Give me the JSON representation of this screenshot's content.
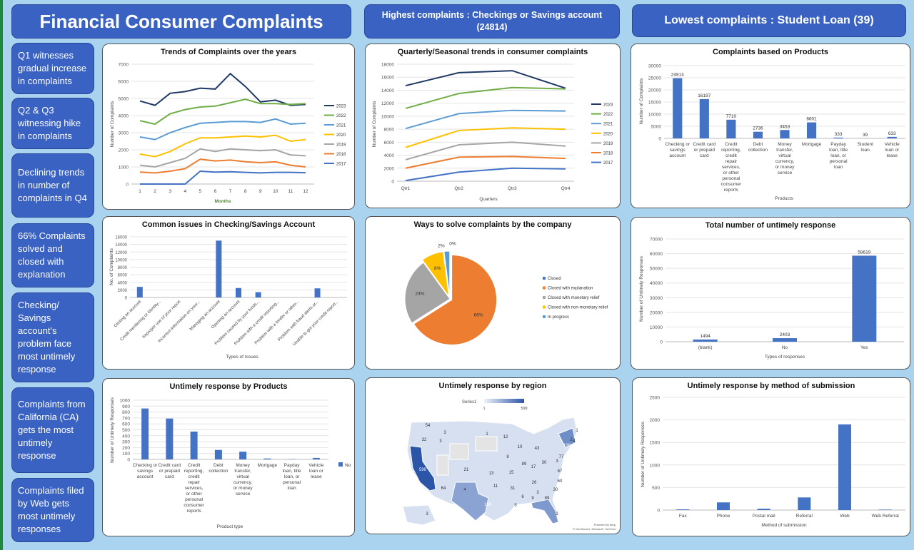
{
  "header": {
    "title": "Financial Consumer Complaints",
    "highest": "Highest complaints : Checkings or Savings account (24814)",
    "lowest": "Lowest complaints : Student Loan (39)"
  },
  "insights": [
    "Q1 witnesses gradual increase in complaints",
    "Q2 & Q3 witnessing hike in complaints",
    "Declining trends in number of complaints in Q4",
    "66% Complaints solved and closed with explanation",
    "Checking/ Savings account's problem face most untimely response",
    "Complaints from California (CA) gets the most untimely response",
    "Complaints filed by Web gets most untimely responses"
  ],
  "colors": {
    "y2023": "#1f3864",
    "y2022": "#70ad47",
    "y2021": "#5b9bd5",
    "y2020": "#ffc000",
    "y2019": "#a5a5a5",
    "y2018": "#ed7d31",
    "y2017": "#4472c4",
    "bar": "#4472c4"
  },
  "chart_data": [
    {
      "id": "trends",
      "type": "line",
      "title": "Trends of Complaints over the years",
      "xlabel": "Months",
      "ylabel": "Number of Complaints",
      "categories": [
        "1",
        "2",
        "3",
        "4",
        "5",
        "6",
        "7",
        "8",
        "9",
        "10",
        "11",
        "12"
      ],
      "ylim": [
        0,
        7000
      ],
      "yticks": [
        0,
        1000,
        2000,
        3000,
        4000,
        5000,
        6000,
        7000
      ],
      "series": [
        {
          "name": "2023",
          "values": [
            4850,
            4600,
            5300,
            5400,
            5600,
            5550,
            6450,
            5700,
            4800,
            4900,
            4600,
            4650
          ]
        },
        {
          "name": "2022",
          "values": [
            3700,
            3500,
            4100,
            4350,
            4500,
            4550,
            4750,
            4950,
            4700,
            4700,
            4650,
            4700
          ]
        },
        {
          "name": "2021",
          "values": [
            2750,
            2600,
            3000,
            3300,
            3550,
            3600,
            3650,
            3650,
            3600,
            3800,
            3500,
            3550
          ]
        },
        {
          "name": "2020",
          "values": [
            1750,
            1600,
            1900,
            2350,
            2700,
            2700,
            2750,
            2800,
            2750,
            2850,
            2500,
            2600
          ]
        },
        {
          "name": "2019",
          "values": [
            1100,
            1000,
            1250,
            1500,
            2050,
            1900,
            2050,
            2000,
            1950,
            2000,
            1700,
            1650
          ]
        },
        {
          "name": "2018",
          "values": [
            700,
            650,
            750,
            900,
            1450,
            1350,
            1400,
            1300,
            1250,
            1300,
            1100,
            1000
          ]
        },
        {
          "name": "2017",
          "values": [
            0,
            0,
            0,
            0,
            750,
            700,
            720,
            680,
            650,
            680,
            680,
            660
          ]
        }
      ]
    },
    {
      "id": "quarterly",
      "type": "line",
      "title": "Quarterly/Seasonal trends in consumer complaints",
      "xlabel": "Quarters",
      "ylabel": "Number of Complaints",
      "categories": [
        "Qtr1",
        "Qtr2",
        "Qtr3",
        "Qtr4"
      ],
      "ylim": [
        0,
        18000
      ],
      "yticks": [
        0,
        2000,
        4000,
        6000,
        8000,
        10000,
        12000,
        14000,
        16000,
        18000
      ],
      "series": [
        {
          "name": "2023",
          "values": [
            14700,
            16700,
            17000,
            14300
          ]
        },
        {
          "name": "2022",
          "values": [
            11200,
            13500,
            14400,
            14200
          ]
        },
        {
          "name": "2021",
          "values": [
            8100,
            10400,
            10900,
            10800
          ]
        },
        {
          "name": "2020",
          "values": [
            5200,
            7800,
            8200,
            8000
          ]
        },
        {
          "name": "2019",
          "values": [
            3300,
            5600,
            6000,
            5400
          ]
        },
        {
          "name": "2018",
          "values": [
            2000,
            3700,
            3800,
            3500
          ]
        },
        {
          "name": "2017",
          "values": [
            100,
            1400,
            2000,
            1900
          ]
        }
      ]
    },
    {
      "id": "products",
      "type": "bar",
      "title": "Complaints based on Products",
      "xlabel": "Products",
      "ylabel": "Number of Complaints",
      "categories": [
        "Checking or savings account",
        "Credit card or prepaid card",
        "Credit reporting, credit repair services, or other personal consumer reports",
        "Debt collection",
        "Money transfer, virtual currency, or money service",
        "Mortgage",
        "Payday loan, title loan, or personal loan",
        "Student loan",
        "Vehicle loan or lease"
      ],
      "values": [
        24814,
        16197,
        7710,
        2736,
        3453,
        6601,
        333,
        39,
        633
      ],
      "ylim": [
        0,
        30000
      ],
      "yticks": [
        0,
        5000,
        10000,
        15000,
        20000,
        25000,
        30000
      ]
    },
    {
      "id": "issues",
      "type": "bar",
      "title": "Common issues in Checking/Savings Account",
      "xlabel": "Types of Issues",
      "ylabel": "No. of Complaints",
      "categories": [
        "Closing an account",
        "Credit monitoring or identity...",
        "Improper use of your report",
        "Incorrect information on your...",
        "Managing an account",
        "Opening an account",
        "Problem caused by your funds...",
        "Problem with a credit reporting...",
        "Problem with a lender or other...",
        "Problem with fraud alerts or...",
        "Unable to get your credit report..."
      ],
      "values": [
        2800,
        0,
        0,
        0,
        15000,
        2500,
        1400,
        0,
        0,
        2400,
        0
      ],
      "ylim": [
        0,
        16000
      ],
      "yticks": [
        0,
        2000,
        4000,
        6000,
        8000,
        10000,
        12000,
        14000,
        16000
      ]
    },
    {
      "id": "resolution",
      "type": "pie",
      "title": "Ways to solve complaints by the company",
      "labels": [
        "Closed",
        "Closed with explanation",
        "Closed with monetary relief",
        "Closed with non-monetary relief",
        "In progress"
      ],
      "values": [
        0,
        66,
        24,
        8,
        2
      ],
      "data_labels": [
        "0%",
        "66%",
        "24%",
        "8%",
        "2%"
      ],
      "colors": [
        "#4472c4",
        "#ed7d31",
        "#a5a5a5",
        "#ffc000",
        "#5b9bd5"
      ],
      "legend": "right"
    },
    {
      "id": "untimely",
      "type": "bar",
      "title": "Total number of untimely response",
      "xlabel": "Types of responses",
      "ylabel": "Number of Untimely Responses",
      "categories": [
        "(blank)",
        "No",
        "Yes"
      ],
      "values": [
        1494,
        2403,
        58619
      ],
      "ylim": [
        0,
        70000
      ],
      "yticks": [
        0,
        10000,
        20000,
        30000,
        40000,
        50000,
        60000,
        70000
      ]
    },
    {
      "id": "untimely_products",
      "type": "bar",
      "title": "Untimely response by Products",
      "xlabel": "Product type",
      "ylabel": "Number of Untimely Responses",
      "categories": [
        "Checking or savings account",
        "Credit card or prepaid card",
        "Credit reporting, credit repair services, or other personal consumer reports",
        "Debt collection",
        "Money transfer, virtual currency, or money service",
        "Mortgage",
        "Payday loan, title loan, or personal loan",
        "Vehicle loan or lease"
      ],
      "series": [
        {
          "name": "No",
          "values": [
            860,
            690,
            470,
            160,
            130,
            15,
            5,
            25
          ]
        }
      ],
      "ylim": [
        0,
        1000
      ],
      "yticks": [
        0,
        100,
        200,
        300,
        400,
        500,
        600,
        700,
        800,
        900,
        1000
      ]
    },
    {
      "id": "region",
      "type": "map",
      "title": "Untimely response by region",
      "legend_series": "Series1",
      "legend_min": "1",
      "legend_max": "599",
      "state_values": [
        "54",
        "3",
        "1",
        "12",
        "32",
        "3",
        "10",
        "43",
        "1",
        "2",
        "4",
        "198",
        "77",
        "8",
        "30",
        "3",
        "89",
        "17",
        "67",
        "21",
        "13",
        "15",
        "599",
        "64",
        "4",
        "11",
        "31",
        "26",
        "60",
        "30",
        "3",
        "6",
        "9",
        "89",
        "5",
        "169",
        "2",
        "3"
      ],
      "credits": [
        "Powered by Bing",
        "© GeoNames, Microsoft, TomTom"
      ]
    },
    {
      "id": "submission",
      "type": "bar",
      "title": "Untimely response by method of submission",
      "xlabel": "Method of submission",
      "ylabel": "Number of Untimely Responses",
      "categories": [
        "Fax",
        "Phone",
        "Postal mail",
        "Referral",
        "Web",
        "Web Referral"
      ],
      "values": [
        15,
        170,
        30,
        280,
        1900,
        10
      ],
      "ylim": [
        0,
        2500
      ],
      "yticks": [
        0,
        500,
        1000,
        1500,
        2000,
        2500
      ]
    }
  ]
}
